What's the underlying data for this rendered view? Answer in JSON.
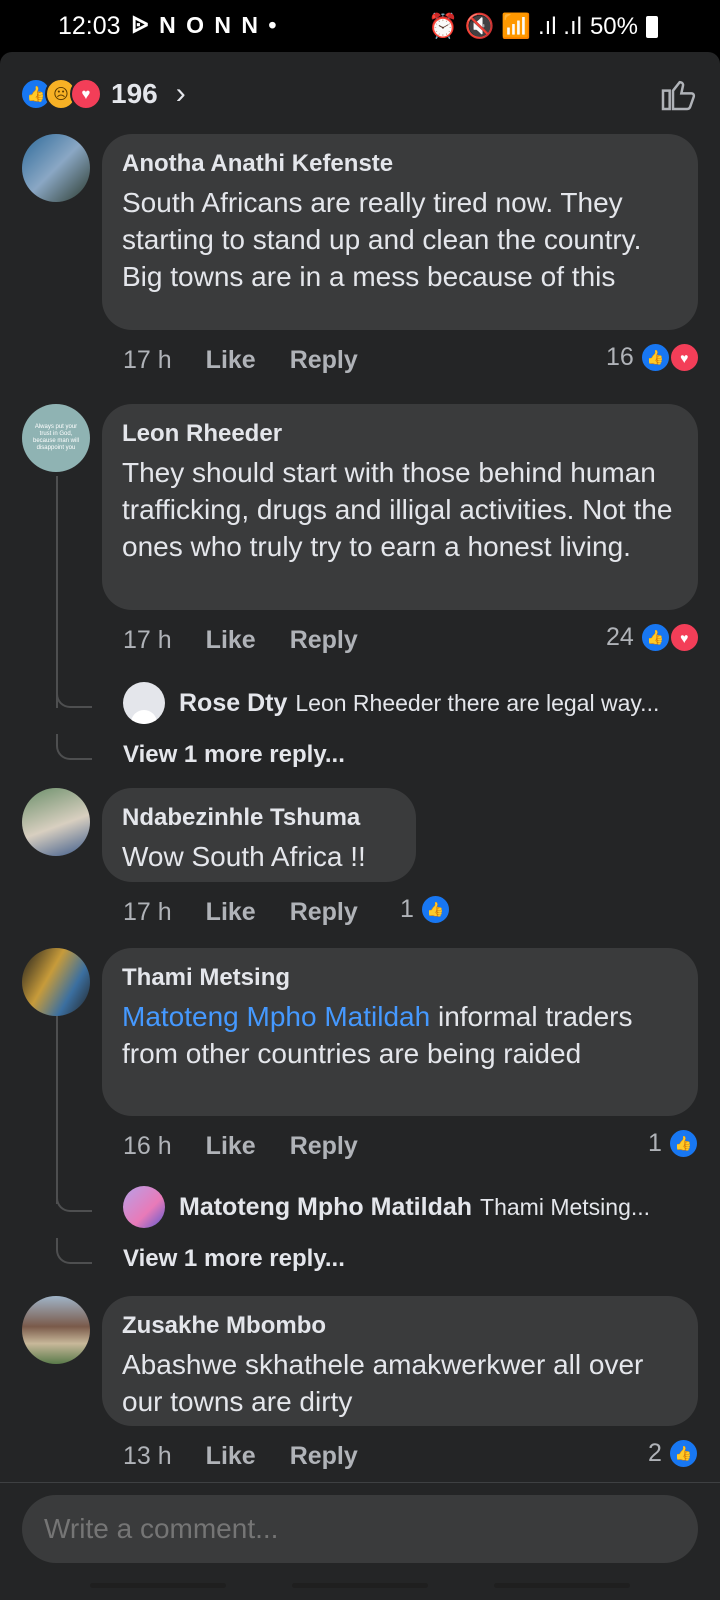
{
  "status": {
    "time": "12:03",
    "left_icons": "ᐉ N O N N •",
    "right_icons": "⏰ 🔇 📶 .ıl .ıl",
    "battery": "50%"
  },
  "reactions": {
    "count": "196",
    "chevron": "›"
  },
  "comments": [
    {
      "author": "Anotha Anathi Kefenste",
      "text": "South Africans are really tired now. They starting to stand up and clean the country. Big towns are in a mess because of this",
      "time": "17 h",
      "like": "Like",
      "reply": "Reply",
      "reactions": "16"
    },
    {
      "author": "Leon Rheeder",
      "text": "They should start with those behind human trafficking, drugs and illigal activities. Not the ones who truly try to earn a honest living.",
      "avatar_text": "Always put your trust in God, because man will disappoint you",
      "time": "17 h",
      "like": "Like",
      "reply": "Reply",
      "reactions": "24",
      "reply_preview": {
        "author": "Rose Dty",
        "text": "Leon Rheeder  there are legal way..."
      },
      "view_more": "View 1 more reply..."
    },
    {
      "author": "Ndabezinhle Tshuma",
      "text": "Wow South Africa !!",
      "time": "17 h",
      "like": "Like",
      "reply": "Reply",
      "reactions": "1"
    },
    {
      "author": "Thami Metsing",
      "mention": "Matoteng Mpho Matildah",
      "text": " informal traders from other countries are being raided",
      "time": "16 h",
      "like": "Like",
      "reply": "Reply",
      "reactions": "1",
      "reply_preview": {
        "author": "Matoteng Mpho Matildah",
        "text": "Thami Metsing..."
      },
      "view_more": "View 1 more reply..."
    },
    {
      "author": "Zusakhe Mbombo",
      "text": "Abashwe skhathele amakwerkwer all over our towns are dirty",
      "time": "13 h",
      "like": "Like",
      "reply": "Reply",
      "reactions": "2"
    }
  ],
  "composer": {
    "placeholder": "Write a comment..."
  },
  "colors": {
    "background": "#242526",
    "bubble": "#3a3b3c",
    "like_blue": "#1877f2",
    "love_red": "#f33e58",
    "mention_blue": "#4599ff"
  }
}
